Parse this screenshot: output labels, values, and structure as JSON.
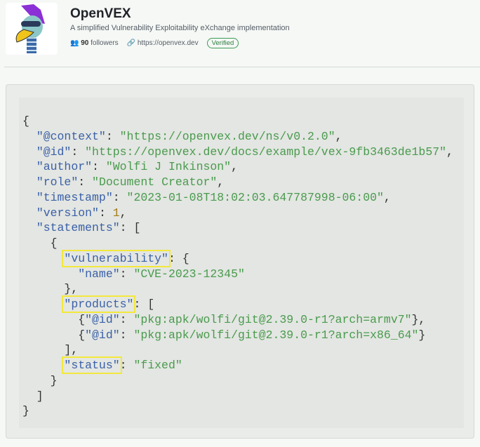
{
  "header": {
    "title": "OpenVEX",
    "description": "A simplified Vulnerability Exploitability eXchange implementation",
    "followers_count": "90",
    "followers_label": "followers",
    "website": "https://openvex.dev",
    "verified_label": "Verified"
  },
  "colors": {
    "key": "#3b60a8",
    "string": "#4a9a4e",
    "number": "#a47c1c",
    "highlight": "#f3e83c"
  },
  "code": {
    "lines": [
      [
        [
          "p",
          "{"
        ]
      ],
      [
        [
          "p",
          "  "
        ],
        [
          "k",
          "\"@context\""
        ],
        [
          "p",
          ": "
        ],
        [
          "s",
          "\"https://openvex.dev/ns/v0.2.0\""
        ],
        [
          "p",
          ","
        ]
      ],
      [
        [
          "p",
          "  "
        ],
        [
          "k",
          "\"@id\""
        ],
        [
          "p",
          ": "
        ],
        [
          "s",
          "\"https://openvex.dev/docs/example/vex-9fb3463de1b57\""
        ],
        [
          "p",
          ","
        ]
      ],
      [
        [
          "p",
          "  "
        ],
        [
          "k",
          "\"author\""
        ],
        [
          "p",
          ": "
        ],
        [
          "s",
          "\"Wolfi J Inkinson\""
        ],
        [
          "p",
          ","
        ]
      ],
      [
        [
          "p",
          "  "
        ],
        [
          "k",
          "\"role\""
        ],
        [
          "p",
          ": "
        ],
        [
          "s",
          "\"Document Creator\""
        ],
        [
          "p",
          ","
        ]
      ],
      [
        [
          "p",
          "  "
        ],
        [
          "k",
          "\"timestamp\""
        ],
        [
          "p",
          ": "
        ],
        [
          "s",
          "\"2023-01-08T18:02:03.647787998-06:00\""
        ],
        [
          "p",
          ","
        ]
      ],
      [
        [
          "p",
          "  "
        ],
        [
          "k",
          "\"version\""
        ],
        [
          "p",
          ": "
        ],
        [
          "n",
          "1"
        ],
        [
          "p",
          ","
        ]
      ],
      [
        [
          "p",
          "  "
        ],
        [
          "k",
          "\"statements\""
        ],
        [
          "p",
          ": ["
        ]
      ],
      [
        [
          "p",
          "    {"
        ]
      ],
      [
        [
          "p",
          "      "
        ],
        [
          "kh",
          "\"vulnerability\""
        ],
        [
          "p",
          ": {"
        ]
      ],
      [
        [
          "p",
          "        "
        ],
        [
          "k",
          "\"name\""
        ],
        [
          "p",
          ": "
        ],
        [
          "s",
          "\"CVE-2023-12345\""
        ]
      ],
      [
        [
          "p",
          "      },"
        ]
      ],
      [
        [
          "p",
          "      "
        ],
        [
          "kh",
          "\"products\""
        ],
        [
          "p",
          ": ["
        ]
      ],
      [
        [
          "p",
          "        {"
        ],
        [
          "k",
          "\"@id\""
        ],
        [
          "p",
          ": "
        ],
        [
          "s",
          "\"pkg:apk/wolfi/git@2.39.0-r1?arch=armv7\""
        ],
        [
          "p",
          "},"
        ]
      ],
      [
        [
          "p",
          "        {"
        ],
        [
          "k",
          "\"@id\""
        ],
        [
          "p",
          ": "
        ],
        [
          "s",
          "\"pkg:apk/wolfi/git@2.39.0-r1?arch=x86_64\""
        ],
        [
          "p",
          "}"
        ]
      ],
      [
        [
          "p",
          "      ],"
        ]
      ],
      [
        [
          "p",
          "      "
        ],
        [
          "kh",
          "\"status\""
        ],
        [
          "p",
          ": "
        ],
        [
          "s",
          "\"fixed\""
        ]
      ],
      [
        [
          "p",
          "    }"
        ]
      ],
      [
        [
          "p",
          "  ]"
        ]
      ],
      [
        [
          "p",
          "}"
        ]
      ]
    ]
  }
}
